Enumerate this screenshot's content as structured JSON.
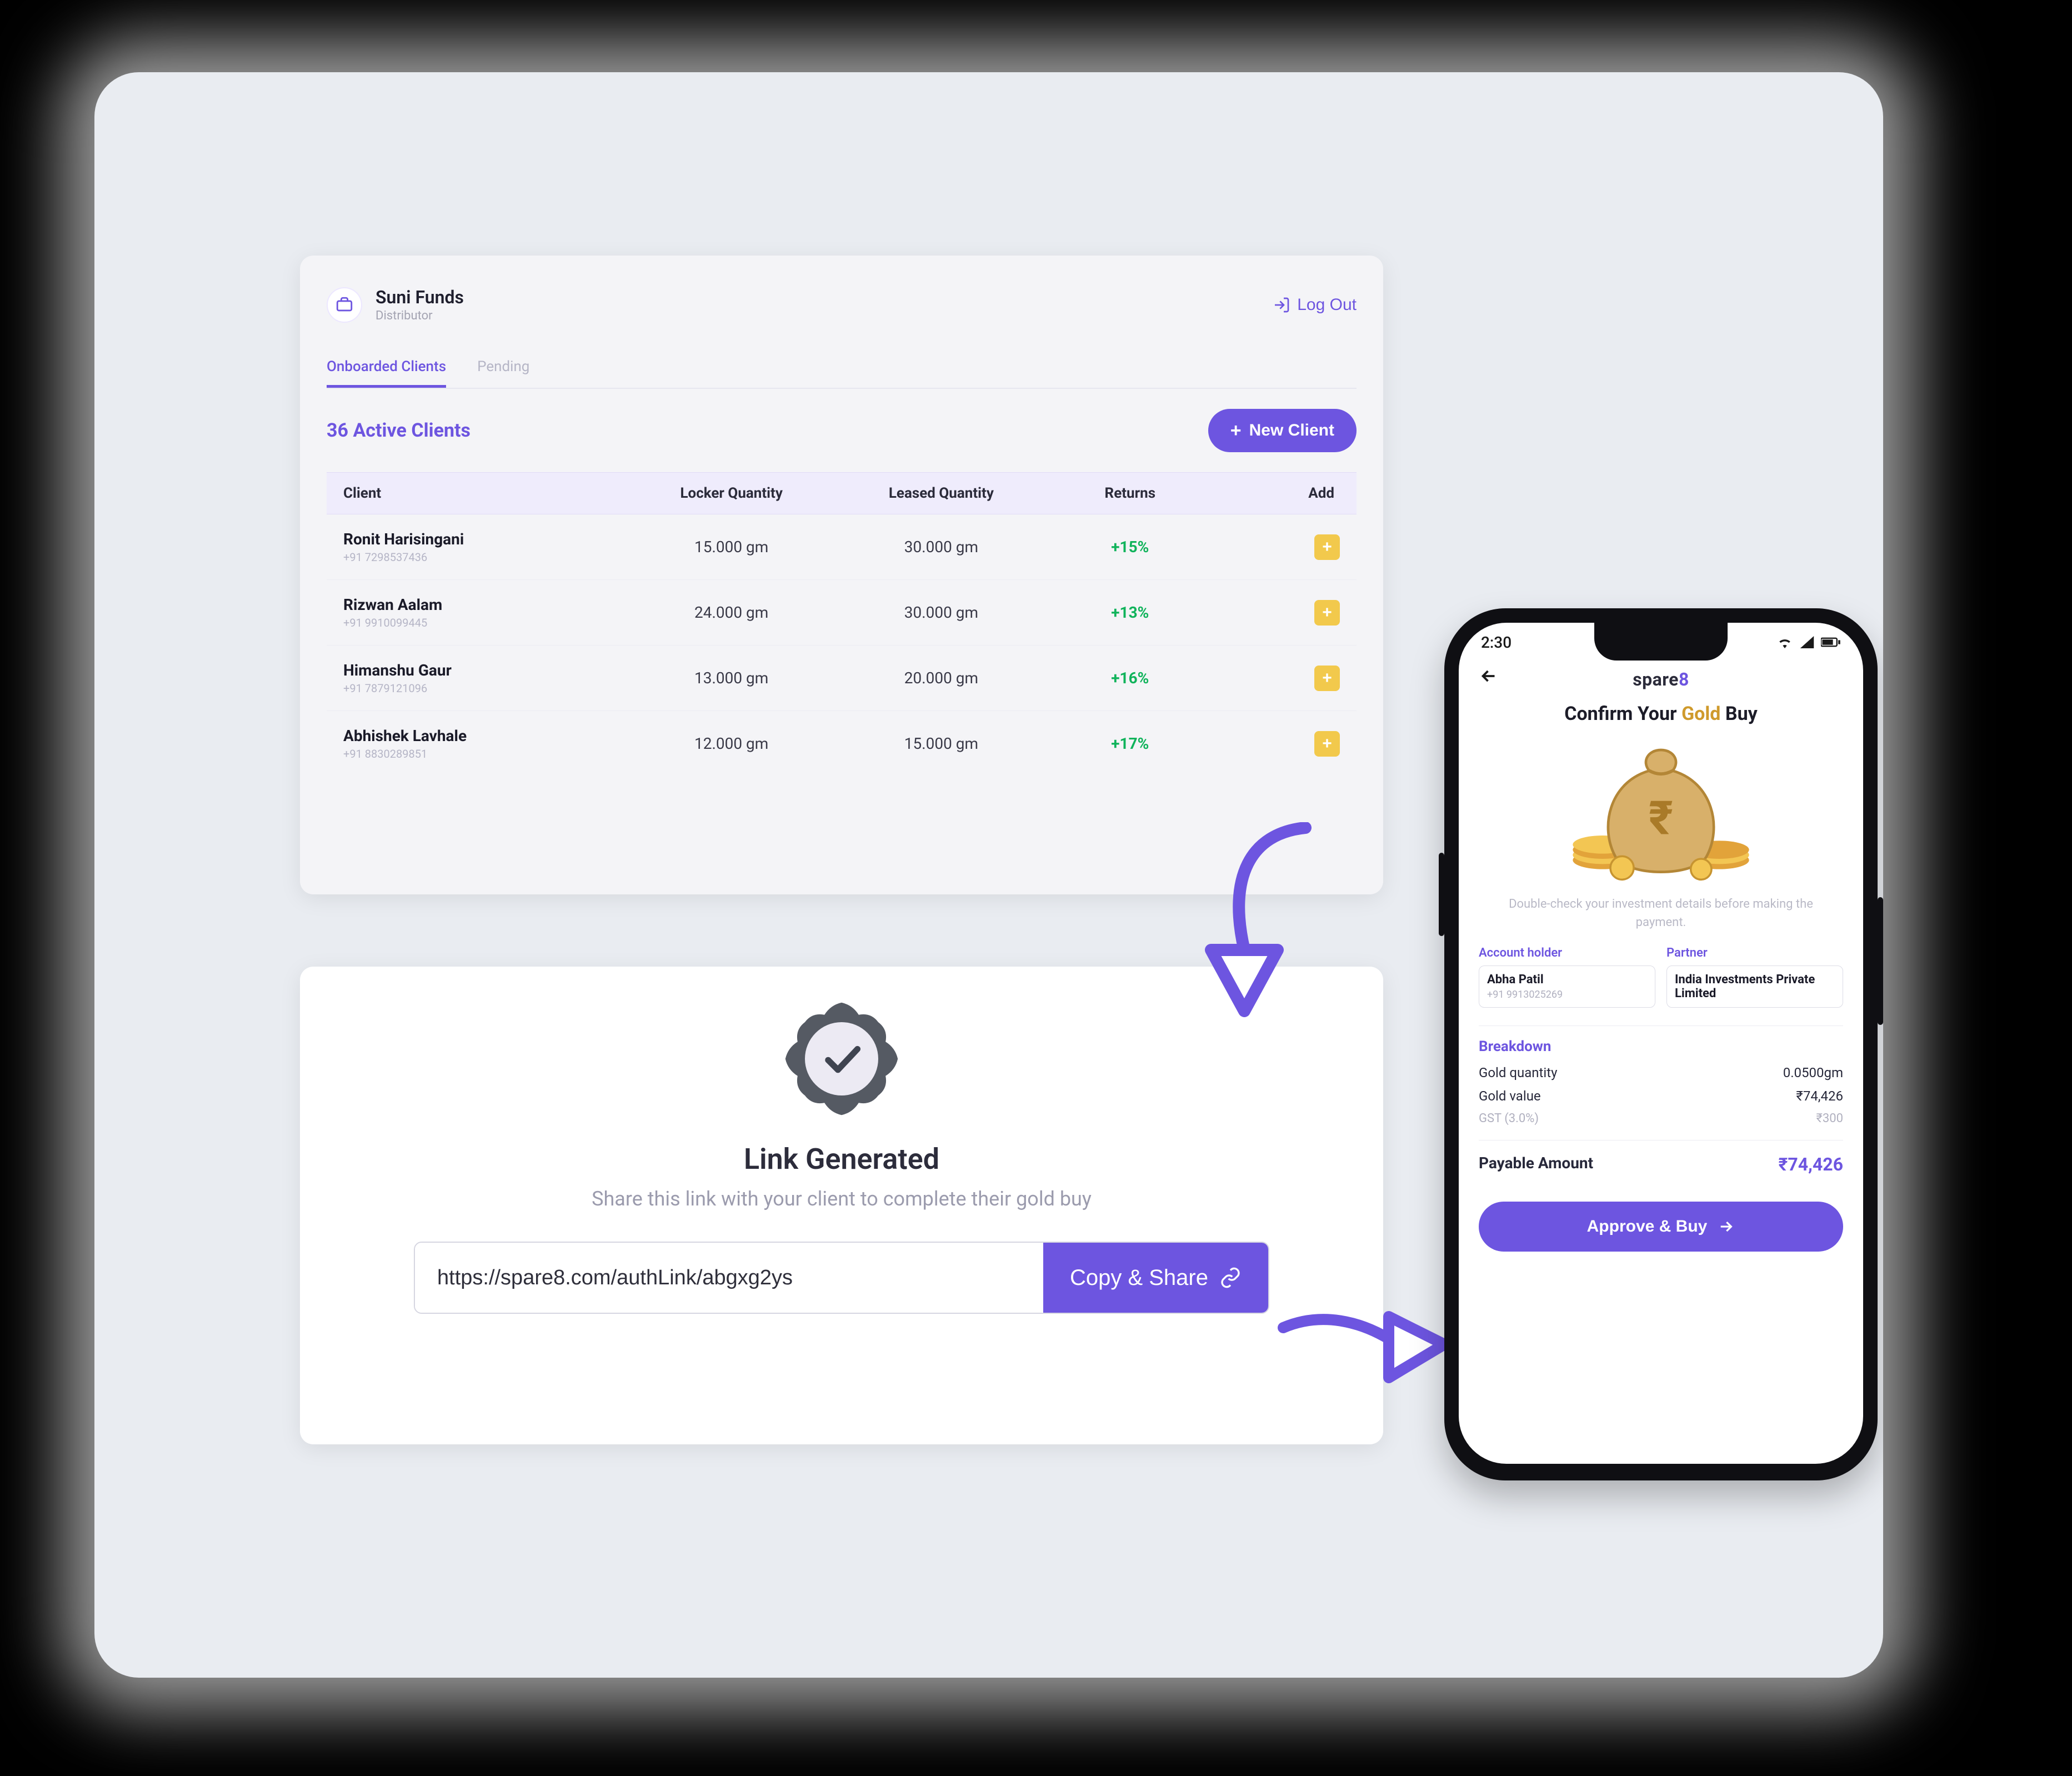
{
  "dashboard": {
    "brand_name": "Suni Funds",
    "brand_sub": "Distributor",
    "logout": "Log Out",
    "tabs": {
      "onboarded": "Onboarded Clients",
      "pending": "Pending"
    },
    "active_clients": "36 Active Clients",
    "new_client": "New Client",
    "columns": {
      "client": "Client",
      "locker": "Locker Quantity",
      "leased": "Leased Quantity",
      "returns": "Returns",
      "add": "Add"
    },
    "rows": [
      {
        "name": "Ronit Harisingani",
        "phone": "+91 7298537436",
        "locker": "15.000 gm",
        "leased": "30.000 gm",
        "returns": "+15%"
      },
      {
        "name": "Rizwan Aalam",
        "phone": "+91 9910099445",
        "locker": "24.000 gm",
        "leased": "30.000 gm",
        "returns": "+13%"
      },
      {
        "name": "Himanshu Gaur",
        "phone": "+91 7879121096",
        "locker": "13.000 gm",
        "leased": "20.000 gm",
        "returns": "+16%"
      },
      {
        "name": "Abhishek Lavhale",
        "phone": "+91 8830289851",
        "locker": "12.000 gm",
        "leased": "15.000 gm",
        "returns": "+17%"
      }
    ]
  },
  "linkcard": {
    "title": "Link Generated",
    "subtitle": "Share this link with your client to complete their gold buy",
    "url": "https://spare8.com/authLink/abgxg2ys",
    "copy": "Copy & Share"
  },
  "phone": {
    "time": "2:30",
    "app_brand_plain": "spare",
    "app_brand_accent": "8",
    "headline_pre": "Confirm Your ",
    "headline_gold": "Gold",
    "headline_post": "  Buy",
    "subtext": "Double-check your investment details before making the payment.",
    "account": {
      "label": "Account holder",
      "name": "Abha Patil",
      "phone": "+91 9913025269"
    },
    "partner": {
      "label": "Partner",
      "name": "India Investments Private Limited"
    },
    "breakdown_title": "Breakdown",
    "rows": {
      "qty_label": "Gold quantity",
      "qty_value": "0.0500gm",
      "val_label": "Gold value",
      "val_value": "₹74,426",
      "gst_label": "GST (3.0%)",
      "gst_value": "₹300",
      "pay_label": "Payable Amount",
      "pay_value": "₹74,426"
    },
    "approve": "Approve & Buy"
  }
}
